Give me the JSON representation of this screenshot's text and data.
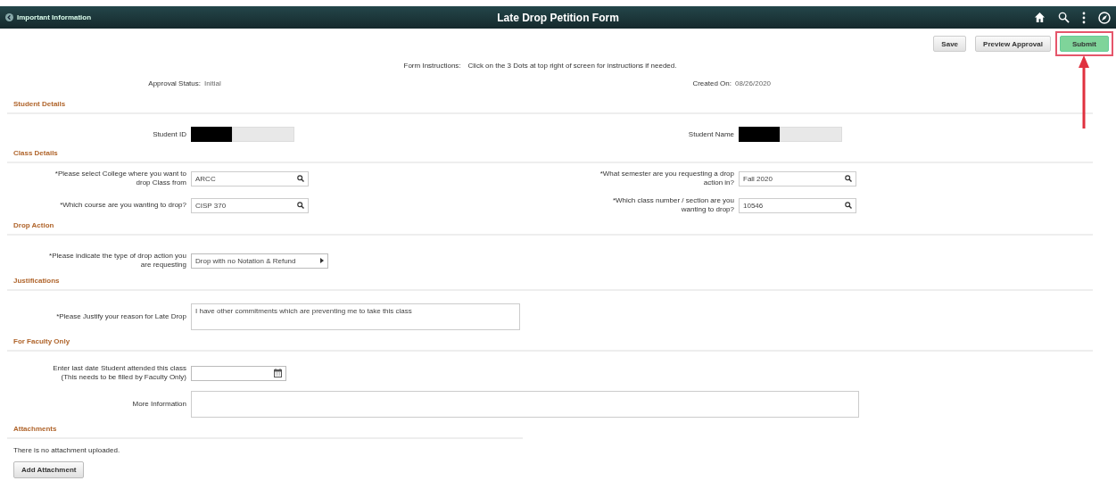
{
  "header": {
    "link": "Important Information",
    "title": "Late Drop Petition Form"
  },
  "buttons": [
    {
      "label": "Save",
      "kind": "plain",
      "highlighted": false
    },
    {
      "label": "Preview Approval",
      "kind": "plain",
      "highlighted": false
    },
    {
      "label": "Submit",
      "kind": "primary",
      "highlighted": true
    }
  ],
  "instructions": {
    "label": "Form Instructions:",
    "text": "Click on the 3 Dots at top right of screen for instructions if needed."
  },
  "status": [
    {
      "label": "Approval Status:",
      "value": "Initial"
    },
    {
      "label": "Created On:",
      "value": "08/26/2020"
    }
  ],
  "sections": [
    {
      "title": "Student Details",
      "rows": [
        [
          {
            "kind": "redacted",
            "label": "Student ID"
          },
          {
            "kind": "redacted",
            "label": "Student Name"
          }
        ]
      ]
    },
    {
      "title": "Class Details",
      "rows": [
        [
          {
            "kind": "lookup",
            "label": "*Please select College where you want to drop Class from",
            "value": "ARCC"
          },
          {
            "kind": "lookup",
            "label": "*What semester are you requesting a drop action in?",
            "value": "Fall 2020"
          }
        ],
        [
          {
            "kind": "lookup",
            "label": "*Which course are you wanting to drop?",
            "value": "CISP 370"
          },
          {
            "kind": "lookup",
            "label": "*Which class number / section are you wanting to drop?",
            "value": "10546"
          }
        ]
      ]
    },
    {
      "title": "Drop Action",
      "rows": [
        [
          {
            "kind": "select",
            "label": "*Please indicate the type of drop action you are requesting",
            "value": "Drop with no Notation & Refund"
          }
        ]
      ]
    },
    {
      "title": "Justifications",
      "rows": [
        [
          {
            "kind": "textarea",
            "label": "*Please Justify your reason for Late Drop",
            "value": "I have other commitments which are preventing me to take this class"
          }
        ]
      ]
    },
    {
      "title": "For Faculty Only",
      "rows": [
        [
          {
            "kind": "date",
            "label": "Enter last date Student attended this class (This needs to be filled by Faculty Only)"
          }
        ],
        [
          {
            "kind": "long-textarea",
            "label": "More Information"
          }
        ]
      ]
    },
    {
      "title": "Attachments",
      "note": "There is no attachment uploaded.",
      "button": "Add Attachment"
    }
  ]
}
